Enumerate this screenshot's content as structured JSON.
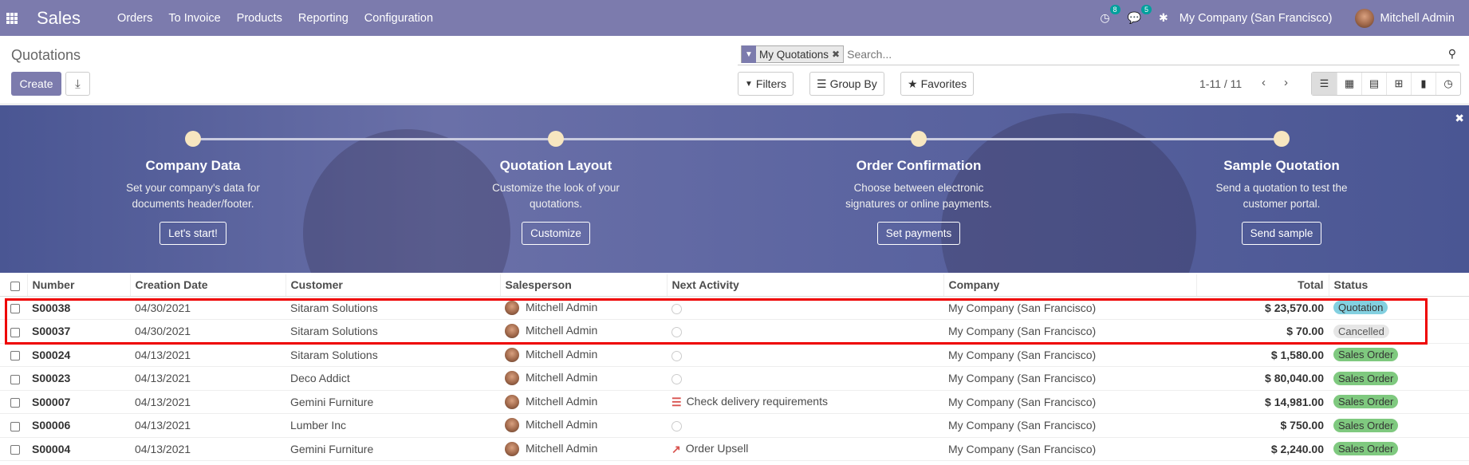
{
  "navbar": {
    "app_name": "Sales",
    "menu": [
      "Orders",
      "To Invoice",
      "Products",
      "Reporting",
      "Configuration"
    ],
    "activity_count": "8",
    "message_count": "5",
    "company": "My Company (San Francisco)",
    "user": "Mitchell Admin"
  },
  "control_panel": {
    "title": "Quotations",
    "create_label": "Create",
    "facet": "My Quotations",
    "search_placeholder": "Search...",
    "filters_label": "Filters",
    "groupby_label": "Group By",
    "favorites_label": "Favorites",
    "pager": "1-11 / 11"
  },
  "banner": {
    "steps": [
      {
        "title": "Company Data",
        "desc": "Set your company's data for documents header/footer.",
        "button": "Let's start!"
      },
      {
        "title": "Quotation Layout",
        "desc": "Customize the look of your quotations.",
        "button": "Customize"
      },
      {
        "title": "Order Confirmation",
        "desc": "Choose between electronic signatures or online payments.",
        "button": "Set payments"
      },
      {
        "title": "Sample Quotation",
        "desc": "Send a quotation to test the customer portal.",
        "button": "Send sample"
      }
    ]
  },
  "table": {
    "headers": [
      "Number",
      "Creation Date",
      "Customer",
      "Salesperson",
      "Next Activity",
      "Company",
      "Total",
      "Status"
    ],
    "rows": [
      {
        "number": "S00038",
        "date": "04/30/2021",
        "customer": "Sitaram Solutions",
        "salesperson": "Mitchell Admin",
        "activity": "",
        "activity_icon": "none",
        "company": "My Company (San Francisco)",
        "total": "$ 23,570.00",
        "status": "Quotation"
      },
      {
        "number": "S00037",
        "date": "04/30/2021",
        "customer": "Sitaram Solutions",
        "salesperson": "Mitchell Admin",
        "activity": "",
        "activity_icon": "none",
        "company": "My Company (San Francisco)",
        "total": "$ 70.00",
        "status": "Cancelled"
      },
      {
        "number": "S00024",
        "date": "04/13/2021",
        "customer": "Sitaram Solutions",
        "salesperson": "Mitchell Admin",
        "activity": "",
        "activity_icon": "none",
        "company": "My Company (San Francisco)",
        "total": "$ 1,580.00",
        "status": "Sales Order"
      },
      {
        "number": "S00023",
        "date": "04/13/2021",
        "customer": "Deco Addict",
        "salesperson": "Mitchell Admin",
        "activity": "",
        "activity_icon": "none",
        "company": "My Company (San Francisco)",
        "total": "$ 80,040.00",
        "status": "Sales Order"
      },
      {
        "number": "S00007",
        "date": "04/13/2021",
        "customer": "Gemini Furniture",
        "salesperson": "Mitchell Admin",
        "activity": "Check delivery requirements",
        "activity_icon": "todo-list-icon",
        "company": "My Company (San Francisco)",
        "total": "$ 14,981.00",
        "status": "Sales Order"
      },
      {
        "number": "S00006",
        "date": "04/13/2021",
        "customer": "Lumber Inc",
        "salesperson": "Mitchell Admin",
        "activity": "",
        "activity_icon": "none",
        "company": "My Company (San Francisco)",
        "total": "$ 750.00",
        "status": "Sales Order"
      },
      {
        "number": "S00004",
        "date": "04/13/2021",
        "customer": "Gemini Furniture",
        "salesperson": "Mitchell Admin",
        "activity": "Order Upsell",
        "activity_icon": "line-chart-icon",
        "company": "My Company (San Francisco)",
        "total": "$ 2,240.00",
        "status": "Sales Order"
      }
    ]
  },
  "colors": {
    "brand": "#7c7bad",
    "status_quotation": "#83d0e0",
    "status_cancelled": "#e6e6e6",
    "status_sales_order": "#7fc97f",
    "highlight": "#ee0000"
  }
}
